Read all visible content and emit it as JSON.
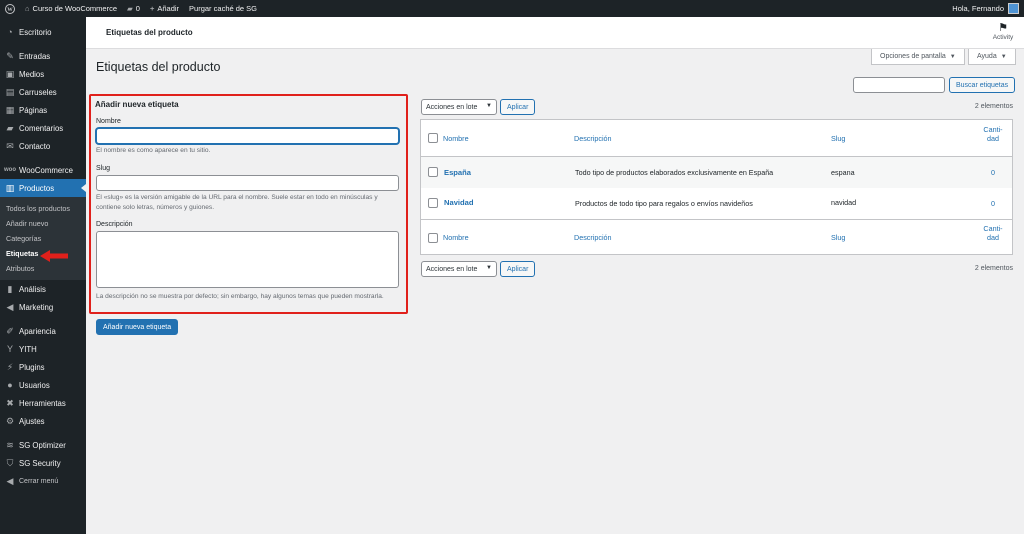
{
  "adminbar": {
    "site_name": "Curso de WooCommerce",
    "comments_count": "0",
    "add_new": "Añadir",
    "purge_cache": "Purgar caché de SG",
    "greeting": "Hola, Fernando"
  },
  "sidebar": {
    "items": [
      {
        "label": "Escritorio",
        "icon": "dashboard-icon"
      },
      {
        "label": "Entradas",
        "icon": "pin-icon"
      },
      {
        "label": "Medios",
        "icon": "media-icon"
      },
      {
        "label": "Carruseles",
        "icon": "carousel-icon"
      },
      {
        "label": "Páginas",
        "icon": "page-icon"
      },
      {
        "label": "Comentarios",
        "icon": "comment-icon"
      },
      {
        "label": "Contacto",
        "icon": "mail-icon"
      },
      {
        "label": "WooCommerce",
        "icon": "woo-icon"
      },
      {
        "label": "Productos",
        "icon": "archive-icon"
      },
      {
        "label": "Análisis",
        "icon": "chart-icon"
      },
      {
        "label": "Marketing",
        "icon": "megaphone-icon"
      },
      {
        "label": "Apariencia",
        "icon": "brush-icon"
      },
      {
        "label": "YITH",
        "icon": "yith-icon"
      },
      {
        "label": "Plugins",
        "icon": "plug-icon"
      },
      {
        "label": "Usuarios",
        "icon": "users-icon"
      },
      {
        "label": "Herramientas",
        "icon": "wrench-icon"
      },
      {
        "label": "Ajustes",
        "icon": "settings-icon"
      },
      {
        "label": "SG Optimizer",
        "icon": "sg-icon"
      },
      {
        "label": "SG Security",
        "icon": "shield-icon"
      },
      {
        "label": "Cerrar menú",
        "icon": "collapse-icon"
      }
    ],
    "submenu": [
      "Todos los productos",
      "Añadir nuevo",
      "Categorías",
      "Etiquetas",
      "Atributos"
    ]
  },
  "header": {
    "title": "Etiquetas del producto",
    "activity": "Activity",
    "screen_options": "Opciones de pantalla",
    "help": "Ayuda"
  },
  "page": {
    "heading": "Etiquetas del producto"
  },
  "form": {
    "heading": "Añadir nueva etiqueta",
    "name_label": "Nombre",
    "name_help": "El nombre es como aparece en tu sitio.",
    "slug_label": "Slug",
    "slug_help": "El «slug» es la versión amigable de la URL para el nombre. Suele estar en todo en minúsculas y contiene solo letras, números y guiones.",
    "desc_label": "Descripción",
    "desc_help": "La descripción no se muestra por defecto; sin embargo, hay algunos temas que pueden mostrarla.",
    "submit": "Añadir nueva etiqueta"
  },
  "list": {
    "search_button": "Buscar etiquetas",
    "bulk_actions": "Acciones en lote",
    "apply": "Aplicar",
    "count": "2 elementos",
    "columns": {
      "name": "Nombre",
      "description": "Descripción",
      "slug": "Slug",
      "count_line1": "Canti-",
      "count_line2": "dad"
    },
    "rows": [
      {
        "name": "España",
        "description": "Todo tipo de productos elaborados exclusivamente en España",
        "slug": "espana",
        "count": "0"
      },
      {
        "name": "Navidad",
        "description": "Productos de todo tipo para regalos o envíos navideños",
        "slug": "navidad",
        "count": "0"
      }
    ]
  },
  "colors": {
    "accent": "#2271b1",
    "highlight": "#e0201b",
    "admin_bar": "#1d2327"
  }
}
